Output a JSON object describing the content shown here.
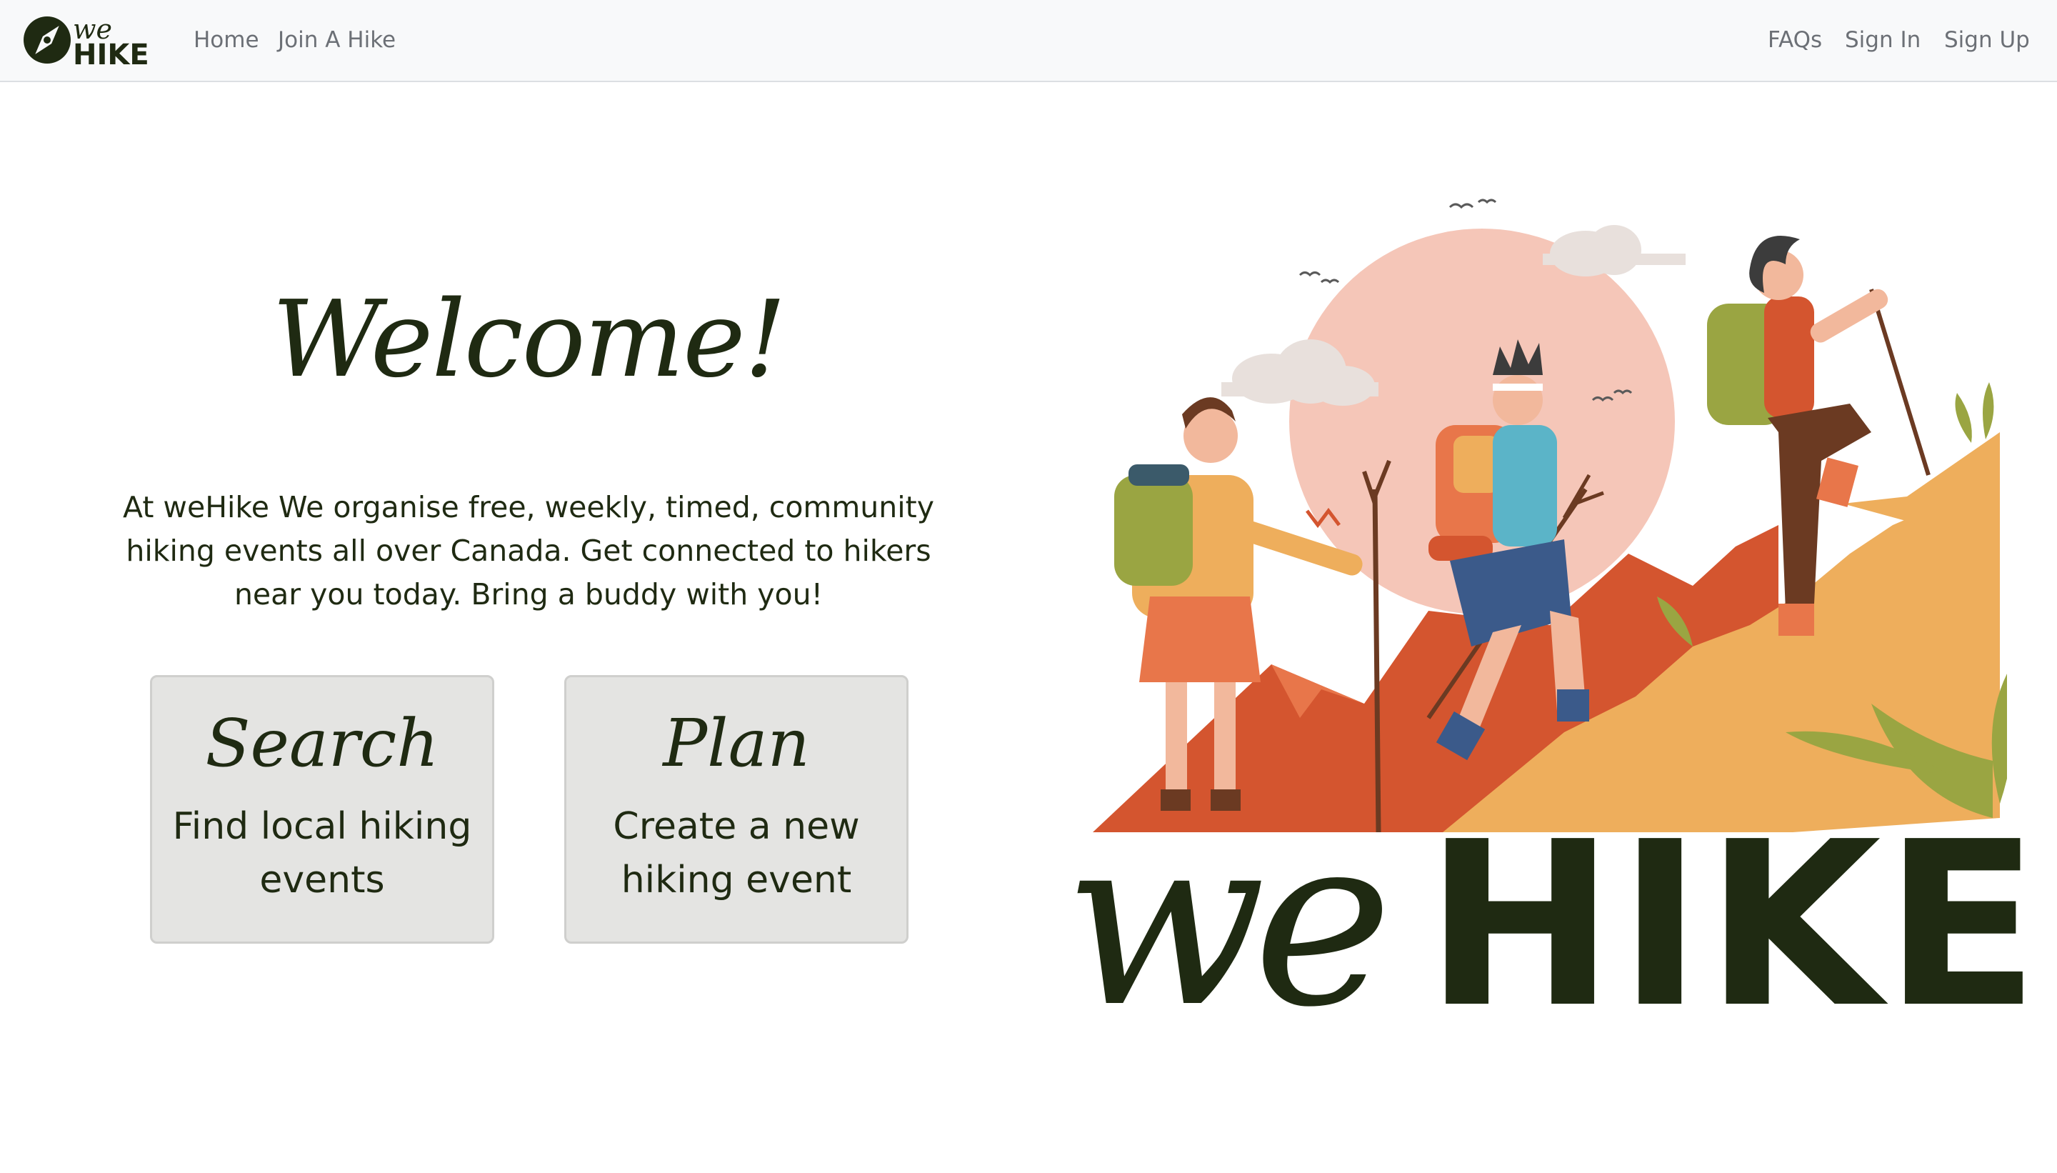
{
  "nav": {
    "brand_top": "we",
    "brand_bottom": "HIKE",
    "home_label": "Home",
    "join_label": "Join A Hike",
    "faqs_label": "FAQs",
    "signin_label": "Sign In",
    "signup_label": "Sign Up"
  },
  "hero": {
    "title": "Welcome!",
    "intro": "At weHike We organise free, weekly, timed, community hiking events all over Canada. Get connected to hikers near you today. Bring a buddy with you!"
  },
  "cards": {
    "search": {
      "title": "Search",
      "text": "Find local hiking events"
    },
    "plan": {
      "title": "Plan",
      "text": "Create a new hiking event"
    }
  },
  "illustration": {
    "wordmark_script": "we",
    "wordmark_bold": "HIKE",
    "icon": "hikers-mountain-illustration"
  },
  "colors": {
    "text_dark": "#1f2a12",
    "nav_bg": "#f8f9fa",
    "nav_link": "#6c7076",
    "card_bg": "#e4e4e2",
    "sun": "#f5c6b8",
    "mountain_red": "#d4552f",
    "mountain_orange": "#eeae5c",
    "leaf_green": "#9aa542"
  }
}
